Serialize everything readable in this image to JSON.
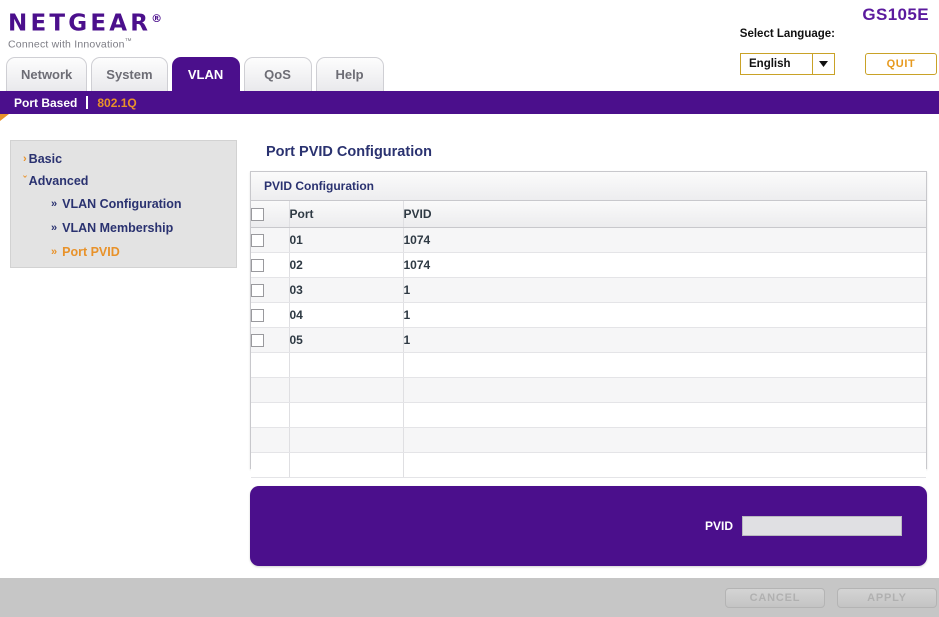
{
  "header": {
    "logo_text": "NETGEAR",
    "logo_registered": "®",
    "tagline": "Connect with Innovation",
    "tagline_tm": "™",
    "model": "GS105E",
    "language_label": "Select Language:",
    "language_value": "English",
    "quit_label": "QUIT",
    "brand_purple": "#4b0f8c",
    "accent_orange": "#e8922a",
    "gold_border": "#c9a227"
  },
  "tabs": [
    {
      "label": "Network",
      "active": false
    },
    {
      "label": "System",
      "active": false
    },
    {
      "label": "VLAN",
      "active": true
    },
    {
      "label": "QoS",
      "active": false
    },
    {
      "label": "Help",
      "active": false
    }
  ],
  "subnav": [
    {
      "label": "Port Based",
      "active": false
    },
    {
      "label": "802.1Q",
      "active": true
    }
  ],
  "sidebar": {
    "groups": [
      {
        "label": "Basic",
        "marker": "›",
        "selected": false
      },
      {
        "label": "Advanced",
        "marker": "ˇ",
        "selected": false
      }
    ],
    "items": [
      {
        "label": "VLAN Configuration",
        "marker": "»",
        "selected": false
      },
      {
        "label": "VLAN Membership",
        "marker": "»",
        "selected": false
      },
      {
        "label": "Port PVID",
        "marker": "»",
        "selected": true
      }
    ]
  },
  "main": {
    "page_title": "Port PVID Configuration",
    "panel_title": "PVID Configuration",
    "columns": [
      "",
      "Port",
      "PVID"
    ],
    "rows": [
      {
        "port": "01",
        "pvid": "1074",
        "checked": false
      },
      {
        "port": "02",
        "pvid": "1074",
        "checked": false
      },
      {
        "port": "03",
        "pvid": "1",
        "checked": false
      },
      {
        "port": "04",
        "pvid": "1",
        "checked": false
      },
      {
        "port": "05",
        "pvid": "1",
        "checked": false
      }
    ],
    "empty_row_count": 5
  },
  "edit_panel": {
    "pvid_label": "PVID",
    "pvid_value": "",
    "pvid_placeholder": ""
  },
  "footer": {
    "cancel_label": "CANCEL",
    "apply_label": "APPLY"
  }
}
